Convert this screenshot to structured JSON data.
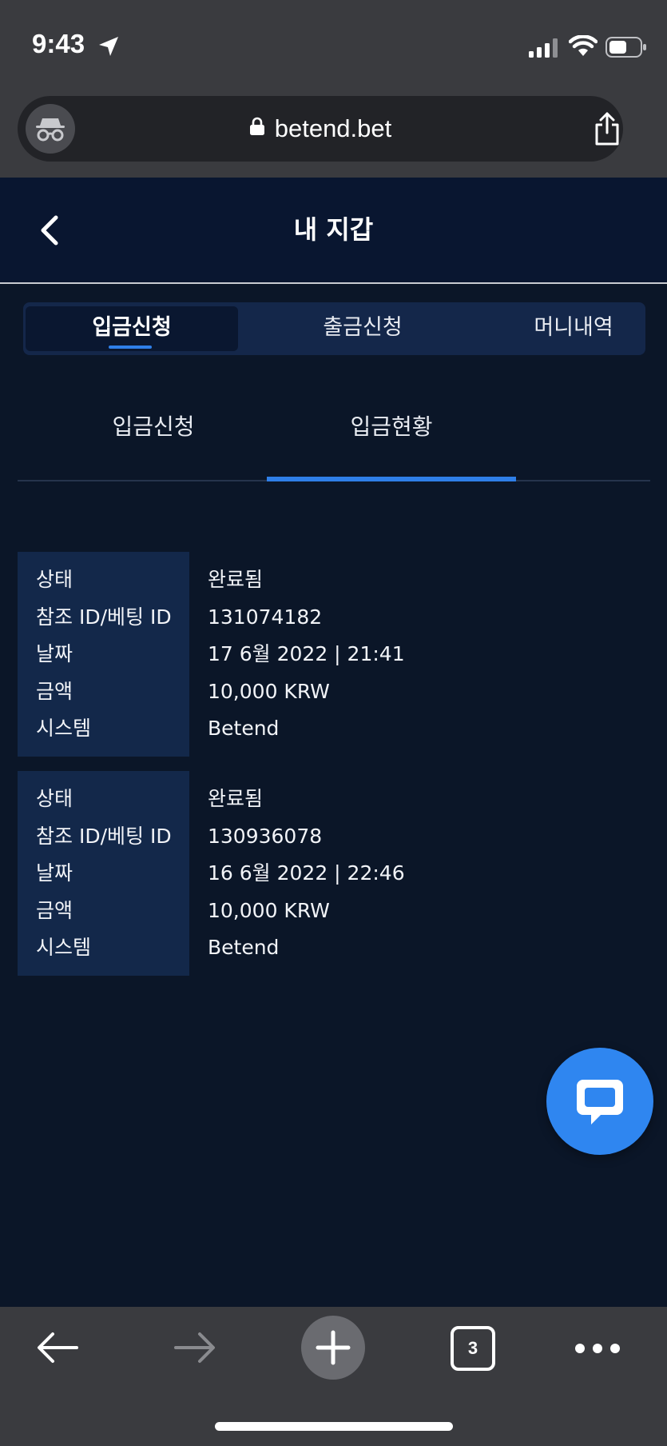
{
  "status_bar": {
    "time": "9:43"
  },
  "browser": {
    "url": "betend.bet",
    "tab_count": "3"
  },
  "header": {
    "title": "내 지갑"
  },
  "main_tabs": [
    {
      "label": "입금신청",
      "active": true
    },
    {
      "label": "출금신청",
      "active": false
    },
    {
      "label": "머니내역",
      "active": false
    }
  ],
  "sub_tabs": [
    {
      "label": "입금신청",
      "active": false
    },
    {
      "label": "입금현황",
      "active": true
    }
  ],
  "records": [
    {
      "status_label": "상태",
      "status": "완료됨",
      "ref_label": "참조 ID/베팅 ID",
      "ref": "131074182",
      "date_label": "날짜",
      "date": "17 6월 2022 | 21:41",
      "amount_label": "금액",
      "amount": "10,000 KRW",
      "system_label": "시스템",
      "system": "Betend"
    },
    {
      "status_label": "상태",
      "status": "완료됨",
      "ref_label": "참조 ID/베팅 ID",
      "ref": "130936078",
      "date_label": "날짜",
      "date": "16 6월 2022 | 22:46",
      "amount_label": "금액",
      "amount": "10,000 KRW",
      "system_label": "시스템",
      "system": "Betend"
    }
  ],
  "colors": {
    "background": "#0b1628",
    "accent": "#2f7fe8",
    "label_cell": "#13284a",
    "chat_button": "#2f86f0"
  }
}
